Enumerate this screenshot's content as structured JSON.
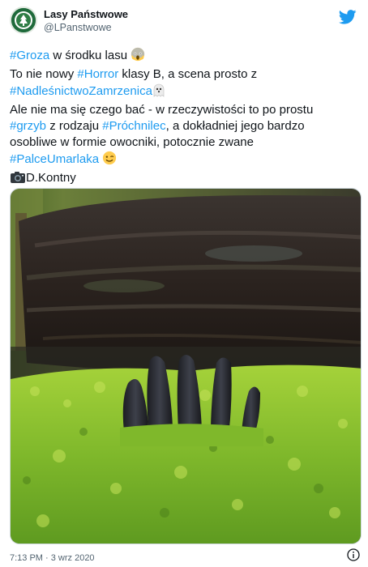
{
  "account": {
    "display_name": "Lasy Państwowe",
    "handle": "@LPanstwowe",
    "avatar_icon": "lasy-panstwowe-logo",
    "brand_icon": "twitter-bird-icon"
  },
  "tweet": {
    "l1_tag": "#Groza",
    "l1_text": " w środku lasu ",
    "l1_emoji": "scream-emoji",
    "l2_text_a": "To nie nowy ",
    "l2_tag": "#Horror",
    "l2_text_b": " klasy B, a scena prosto z",
    "l3_tag": "#NadleśnictwoZamrzenica",
    "l3_emoji": "ghost-emoji",
    "l4_text": "Ale nie ma się czego bać - w rzeczywistości to po prostu",
    "l5_tag_a": "#grzyb",
    "l5_text_a": " z rodzaju ",
    "l5_tag_b": "#Próchnilec",
    "l5_text_b": ", a dokładniej jego bardzo",
    "l6_text": "osobliwe w formie owocniki, potocznie zwane",
    "l7_tag": "#PalceUmarlaka",
    "l7_emoji": "wink-emoji",
    "l8_emoji": "camera-emoji",
    "l8_text": "D.Kontny"
  },
  "media": {
    "subject": "dead-mans-fingers-fungus-photo"
  },
  "footer": {
    "timestamp": "7:13 PM · 3 wrz 2020",
    "info_icon": "info-icon"
  },
  "colors": {
    "link": "#1d9bf0",
    "text": "#0f1419",
    "muted": "#536471",
    "brand": "#1d9bf0"
  }
}
